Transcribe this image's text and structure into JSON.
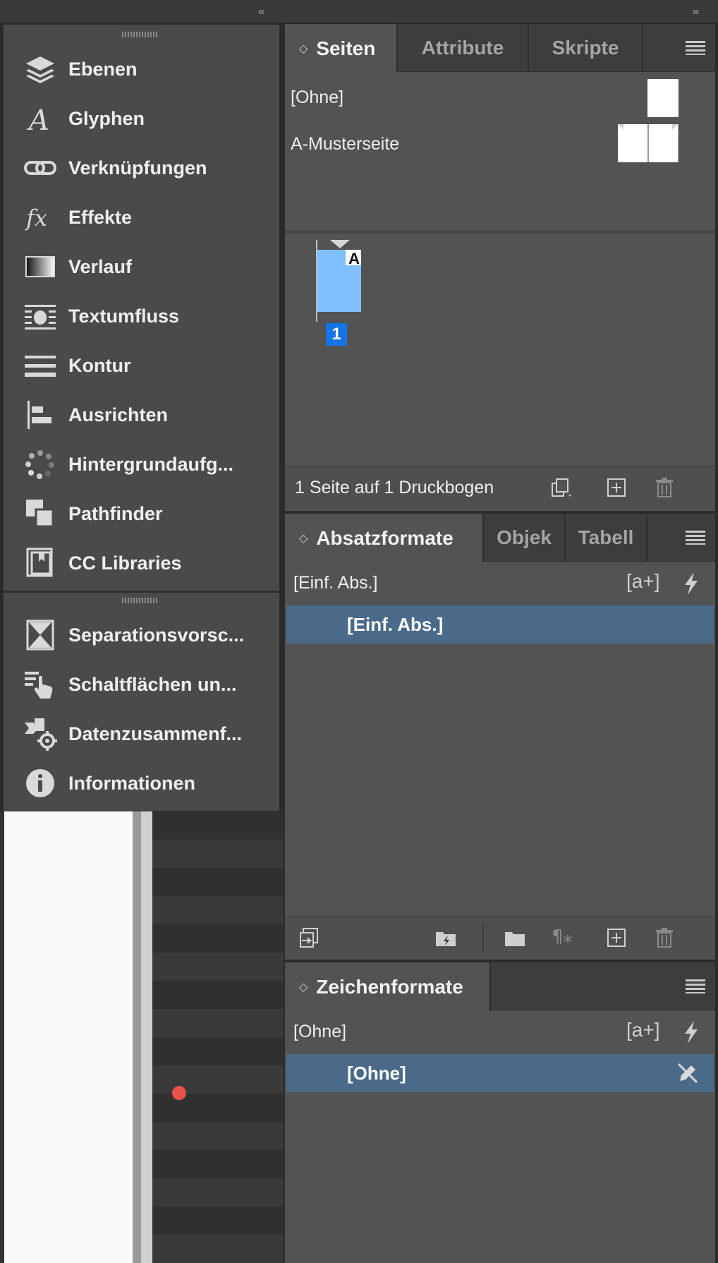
{
  "dock": {
    "collapse_left": "‹‹",
    "collapse_right": "››",
    "items": [
      {
        "label": "Ebenen",
        "icon": "layers-icon"
      },
      {
        "label": "Glyphen",
        "icon": "glyphs-icon"
      },
      {
        "label": "Verknüpfungen",
        "icon": "links-icon"
      },
      {
        "label": "Effekte",
        "icon": "effects-icon"
      },
      {
        "label": "Verlauf",
        "icon": "gradient-icon"
      },
      {
        "label": "Textumfluss",
        "icon": "text-wrap-icon"
      },
      {
        "label": "Kontur",
        "icon": "stroke-icon"
      },
      {
        "label": "Ausrichten",
        "icon": "align-icon"
      },
      {
        "label": "Hintergrundaufg...",
        "icon": "background-tasks-icon"
      },
      {
        "label": "Pathfinder",
        "icon": "pathfinder-icon"
      },
      {
        "label": "CC Libraries",
        "icon": "cc-libraries-icon"
      }
    ],
    "items2": [
      {
        "label": "Separationsvorsc...",
        "icon": "separations-preview-icon"
      },
      {
        "label": "Schaltflächen un...",
        "icon": "buttons-forms-icon"
      },
      {
        "label": "Datenzusammenf...",
        "icon": "data-merge-icon"
      },
      {
        "label": "Informationen",
        "icon": "info-icon"
      }
    ]
  },
  "pages_panel": {
    "tabs": [
      "Seiten",
      "Attribute",
      "Skripte"
    ],
    "chevron": "◇",
    "masters": [
      {
        "label": "[Ohne]"
      },
      {
        "label": "A-Musterseite"
      }
    ],
    "page_master_letter": "A",
    "page_number": "1",
    "status": "1 Seite auf 1 Druckbogen"
  },
  "paragraph_panel": {
    "tabs": [
      "Absatzformate",
      "Objek",
      "Tabell"
    ],
    "current": "[Einf. Abs.]",
    "selected_item": "[Einf. Abs.]"
  },
  "character_panel": {
    "tabs": [
      "Zeichenformate"
    ],
    "current": "[Ohne]",
    "selected_item": "[Ohne]"
  },
  "colors": {
    "panel_bg": "#535353",
    "selection": "#4b6a8a",
    "page_blue": "#7fbfff",
    "page_number_bg": "#1473e6"
  }
}
